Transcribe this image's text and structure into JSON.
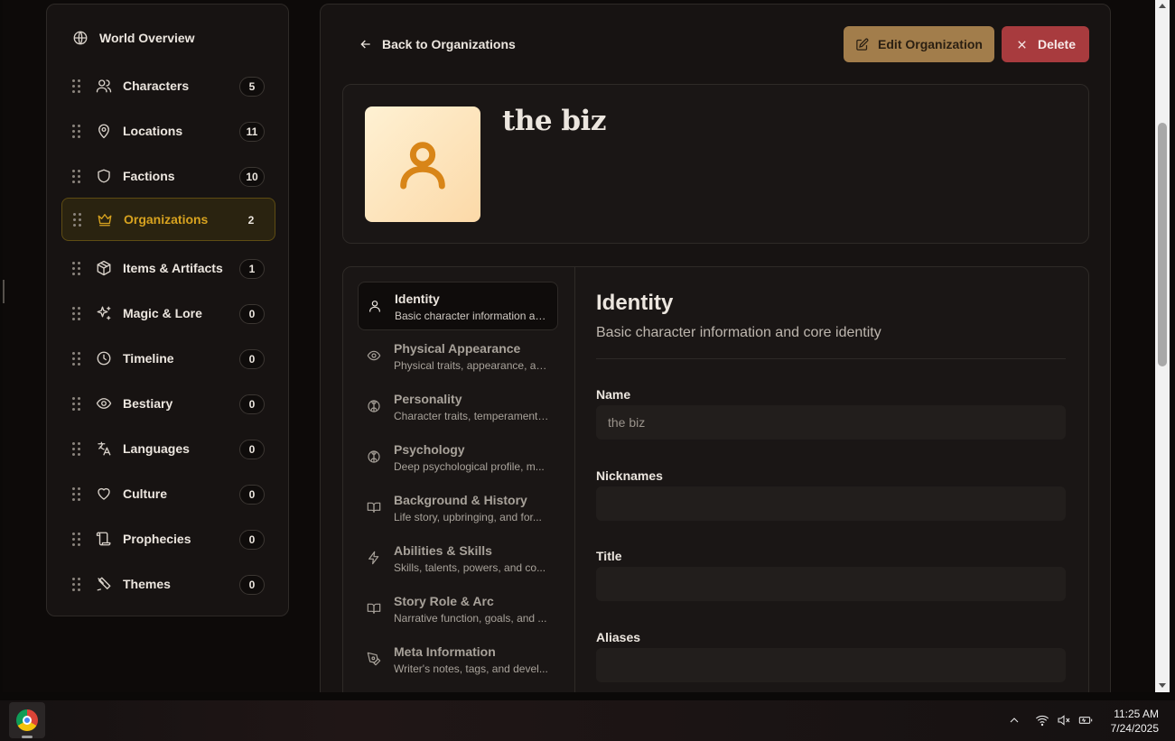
{
  "sidebar": {
    "overview_label": "World Overview",
    "items": [
      {
        "label": "Characters",
        "count": "5",
        "icon": "users-icon"
      },
      {
        "label": "Locations",
        "count": "11",
        "icon": "map-pin-icon"
      },
      {
        "label": "Factions",
        "count": "10",
        "icon": "shield-icon"
      },
      {
        "label": "Organizations",
        "count": "2",
        "icon": "crown-icon",
        "active": true
      },
      {
        "label": "Items & Artifacts",
        "count": "1",
        "icon": "box-icon"
      },
      {
        "label": "Magic & Lore",
        "count": "0",
        "icon": "sparkles-icon"
      },
      {
        "label": "Timeline",
        "count": "0",
        "icon": "clock-icon"
      },
      {
        "label": "Bestiary",
        "count": "0",
        "icon": "eye-icon"
      },
      {
        "label": "Languages",
        "count": "0",
        "icon": "languages-icon"
      },
      {
        "label": "Culture",
        "count": "0",
        "icon": "heart-icon"
      },
      {
        "label": "Prophecies",
        "count": "0",
        "icon": "scroll-icon"
      },
      {
        "label": "Themes",
        "count": "0",
        "icon": "pen-tool-icon"
      }
    ]
  },
  "header": {
    "back_label": "Back to Organizations",
    "edit_label": "Edit Organization",
    "delete_label": "Delete",
    "title": "the biz"
  },
  "sections": [
    {
      "title": "Identity",
      "desc": "Basic character information an...",
      "icon": "user-icon",
      "active": true
    },
    {
      "title": "Physical Appearance",
      "desc": "Physical traits, appearance, an...",
      "icon": "eye-icon"
    },
    {
      "title": "Personality",
      "desc": "Character traits, temperament,...",
      "icon": "brain-icon"
    },
    {
      "title": "Psychology",
      "desc": "Deep psychological profile, m...",
      "icon": "brain-icon"
    },
    {
      "title": "Background & History",
      "desc": "Life story, upbringing, and for...",
      "icon": "book-icon"
    },
    {
      "title": "Abilities & Skills",
      "desc": "Skills, talents, powers, and co...",
      "icon": "zap-icon"
    },
    {
      "title": "Story Role & Arc",
      "desc": "Narrative function, goals, and ...",
      "icon": "book-open-icon"
    },
    {
      "title": "Meta Information",
      "desc": "Writer's notes, tags, and devel...",
      "icon": "pen-tool-icon"
    }
  ],
  "panel": {
    "title": "Identity",
    "desc": "Basic character information and core identity",
    "fields": [
      {
        "label": "Name",
        "value": "the biz"
      },
      {
        "label": "Nicknames",
        "value": ""
      },
      {
        "label": "Title",
        "value": ""
      },
      {
        "label": "Aliases",
        "value": ""
      }
    ]
  },
  "taskbar": {
    "time": "11:25 AM",
    "date": "7/24/2025"
  },
  "colors": {
    "accent": "#d7a21f",
    "edit_button": "#a27d4b",
    "delete_button": "#a83b3e",
    "background": "#0d0a09",
    "card": "#171312"
  }
}
